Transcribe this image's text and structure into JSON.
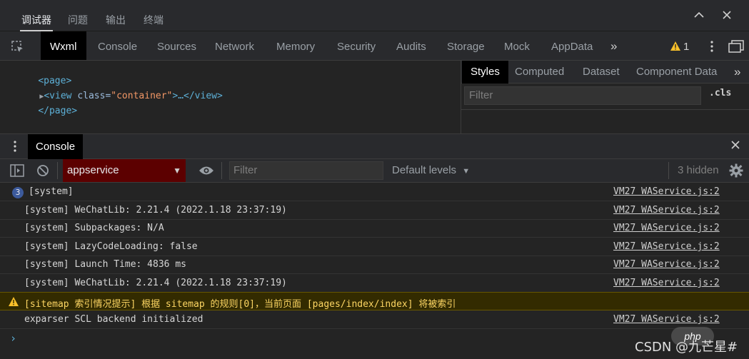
{
  "panel_tabs": [
    {
      "label": "调试器",
      "active": true
    },
    {
      "label": "问题",
      "active": false
    },
    {
      "label": "输出",
      "active": false
    },
    {
      "label": "终端",
      "active": false
    }
  ],
  "devtools_tabs": [
    "Wxml",
    "Console",
    "Sources",
    "Network",
    "Memory",
    "Security",
    "Audits",
    "Storage",
    "Mock",
    "AppData"
  ],
  "active_devtools_tab": "Wxml",
  "warning_count": "1",
  "elements": {
    "line1_tag": "<page>",
    "line2_open": "<view ",
    "line2_attr": "class=",
    "line2_val": "\"container\"",
    "line2_rest": ">…</view>",
    "line3_tag": "</page>"
  },
  "styles_tabs": [
    "Styles",
    "Computed",
    "Dataset",
    "Component Data"
  ],
  "styles_filter_placeholder": "Filter",
  "cls_label": ".cls",
  "console": {
    "drawer_tab": "Console",
    "context": "appservice",
    "filter_placeholder": "Filter",
    "levels": "Default levels",
    "hidden": "3 hidden",
    "messages": [
      {
        "badge": "3",
        "text": "[system]",
        "source": "VM27 WAService.js:2",
        "type": "group"
      },
      {
        "text": "[system] WeChatLib: 2.21.4 (2022.1.18 23:37:19)",
        "source": "VM27 WAService.js:2",
        "type": "log"
      },
      {
        "text": "[system] Subpackages: N/A",
        "source": "VM27 WAService.js:2",
        "type": "log"
      },
      {
        "text": "[system] LazyCodeLoading: false",
        "source": "VM27 WAService.js:2",
        "type": "log"
      },
      {
        "text": "[system] Launch Time: 4836 ms",
        "source": "VM27 WAService.js:2",
        "type": "log"
      },
      {
        "text": "[system] WeChatLib: 2.21.4 (2022.1.18 23:37:19)",
        "source": "VM27 WAService.js:2",
        "type": "log"
      },
      {
        "text": "[sitemap 索引情况提示] 根据 sitemap 的规则[0]，当前页面 [pages/index/index] 将被索引",
        "source": "",
        "type": "warn"
      },
      {
        "text": "exparser SCL backend initialized",
        "source": "VM27 WAService.js:2",
        "type": "log"
      }
    ],
    "prompt": "›"
  },
  "watermark": "CSDN @九芒星#",
  "watermark_logo": "php"
}
